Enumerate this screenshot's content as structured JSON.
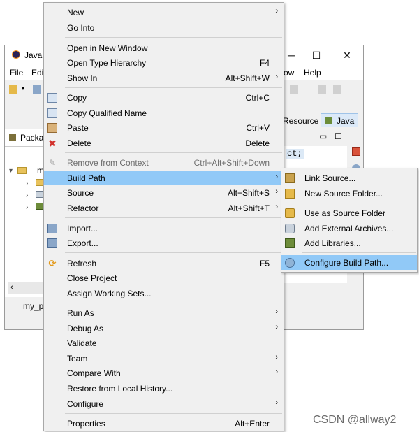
{
  "window": {
    "title": "Java -",
    "menubar": [
      "File",
      "Edi",
      "ow",
      "Help"
    ],
    "perspective_label": "Resource",
    "perspective_active": "Java",
    "package_tab_label": "Packa",
    "tree_root_label": "m",
    "editor_text": "ct;",
    "status_text": "my_p"
  },
  "context_menu": {
    "items": [
      {
        "label": "New",
        "shortcut": "",
        "submenu": true
      },
      {
        "label": "Go Into",
        "shortcut": "",
        "submenu": false
      },
      {
        "label": "Open in New Window",
        "shortcut": "",
        "submenu": false
      },
      {
        "label": "Open Type Hierarchy",
        "shortcut": "F4",
        "submenu": false
      },
      {
        "label": "Show In",
        "shortcut": "Alt+Shift+W",
        "submenu": true
      },
      {
        "label": "Copy",
        "shortcut": "Ctrl+C",
        "submenu": false,
        "icon": "copy-icon"
      },
      {
        "label": "Copy Qualified Name",
        "shortcut": "",
        "submenu": false,
        "icon": "copy-qualified-name-icon"
      },
      {
        "label": "Paste",
        "shortcut": "Ctrl+V",
        "submenu": false,
        "icon": "paste-icon"
      },
      {
        "label": "Delete",
        "shortcut": "Delete",
        "submenu": false,
        "icon": "delete-icon"
      },
      {
        "label": "Remove from Context",
        "shortcut": "Ctrl+Alt+Shift+Down",
        "submenu": false,
        "disabled": true,
        "icon": "remove-context-icon"
      },
      {
        "label": "Build Path",
        "shortcut": "",
        "submenu": true,
        "highlighted": true
      },
      {
        "label": "Source",
        "shortcut": "Alt+Shift+S",
        "submenu": true
      },
      {
        "label": "Refactor",
        "shortcut": "Alt+Shift+T",
        "submenu": true
      },
      {
        "label": "Import...",
        "shortcut": "",
        "submenu": false,
        "icon": "import-icon"
      },
      {
        "label": "Export...",
        "shortcut": "",
        "submenu": false,
        "icon": "export-icon"
      },
      {
        "label": "Refresh",
        "shortcut": "F5",
        "submenu": false,
        "icon": "refresh-icon"
      },
      {
        "label": "Close Project",
        "shortcut": "",
        "submenu": false
      },
      {
        "label": "Assign Working Sets...",
        "shortcut": "",
        "submenu": false
      },
      {
        "label": "Run As",
        "shortcut": "",
        "submenu": true
      },
      {
        "label": "Debug As",
        "shortcut": "",
        "submenu": true
      },
      {
        "label": "Validate",
        "shortcut": "",
        "submenu": false
      },
      {
        "label": "Team",
        "shortcut": "",
        "submenu": true
      },
      {
        "label": "Compare With",
        "shortcut": "",
        "submenu": true
      },
      {
        "label": "Restore from Local History...",
        "shortcut": "",
        "submenu": false
      },
      {
        "label": "Configure",
        "shortcut": "",
        "submenu": true
      },
      {
        "label": "Properties",
        "shortcut": "Alt+Enter",
        "submenu": false
      }
    ]
  },
  "build_path_submenu": {
    "items": [
      {
        "label": "Link Source...",
        "icon": "link-source-icon"
      },
      {
        "label": "New Source Folder...",
        "icon": "new-source-folder-icon"
      },
      {
        "label": "Use as Source Folder",
        "icon": "use-as-source-folder-icon"
      },
      {
        "label": "Add External Archives...",
        "icon": "add-external-archives-icon"
      },
      {
        "label": "Add Libraries...",
        "icon": "add-libraries-icon"
      },
      {
        "label": "Configure Build Path...",
        "icon": "configure-build-path-icon",
        "highlighted": true
      }
    ]
  },
  "watermark": "CSDN @allway2",
  "colors": {
    "highlight": "#91c9f7",
    "menu_bg": "#f0f0f0",
    "disabled_text": "#6d6d6d"
  }
}
